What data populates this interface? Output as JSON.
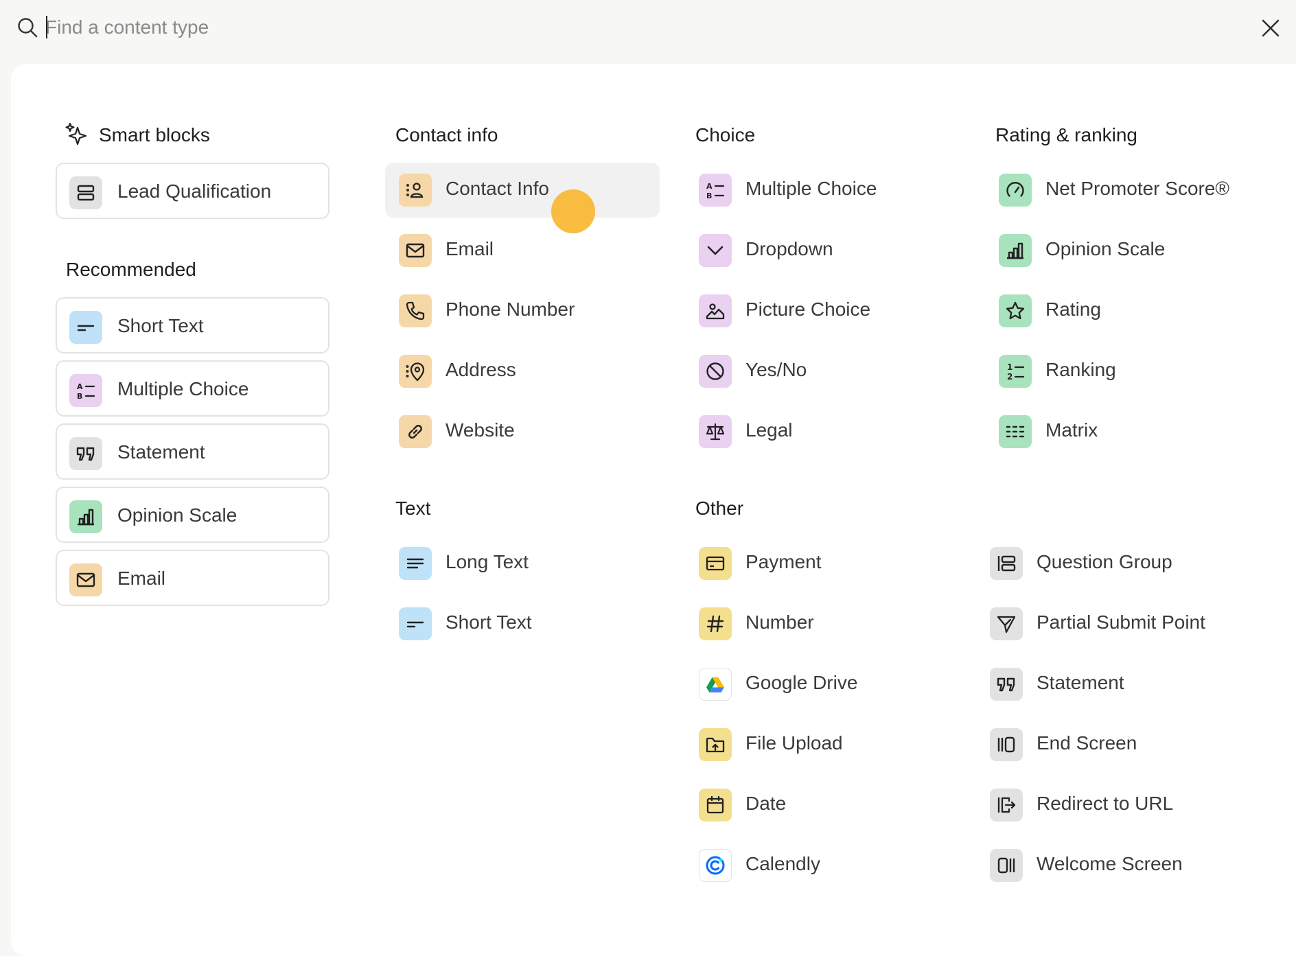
{
  "search": {
    "placeholder": "Find a content type",
    "value": ""
  },
  "sections": {
    "smart_blocks": {
      "title": "Smart blocks",
      "items": [
        {
          "label": "Lead Qualification",
          "icon": "stack-icon"
        }
      ]
    },
    "recommended": {
      "title": "Recommended",
      "items": [
        {
          "label": "Short Text",
          "icon": "short-text-icon"
        },
        {
          "label": "Multiple Choice",
          "icon": "multiple-choice-icon"
        },
        {
          "label": "Statement",
          "icon": "quote-icon"
        },
        {
          "label": "Opinion Scale",
          "icon": "bar-chart-icon"
        },
        {
          "label": "Email",
          "icon": "envelope-icon"
        }
      ]
    },
    "contact_info": {
      "title": "Contact info",
      "items": [
        {
          "label": "Contact Info",
          "icon": "contact-card-icon"
        },
        {
          "label": "Email",
          "icon": "envelope-icon"
        },
        {
          "label": "Phone Number",
          "icon": "phone-icon"
        },
        {
          "label": "Address",
          "icon": "location-pin-icon"
        },
        {
          "label": "Website",
          "icon": "link-icon"
        }
      ]
    },
    "choice": {
      "title": "Choice",
      "items": [
        {
          "label": "Multiple Choice",
          "icon": "multiple-choice-icon"
        },
        {
          "label": "Dropdown",
          "icon": "chevron-down-icon"
        },
        {
          "label": "Picture Choice",
          "icon": "image-icon"
        },
        {
          "label": "Yes/No",
          "icon": "yes-no-icon"
        },
        {
          "label": "Legal",
          "icon": "scales-icon"
        }
      ]
    },
    "rating": {
      "title": "Rating & ranking",
      "items": [
        {
          "label": "Net Promoter Score®",
          "icon": "gauge-icon"
        },
        {
          "label": "Opinion Scale",
          "icon": "bar-chart-icon"
        },
        {
          "label": "Rating",
          "icon": "star-icon"
        },
        {
          "label": "Ranking",
          "icon": "ranking-icon"
        },
        {
          "label": "Matrix",
          "icon": "matrix-icon"
        }
      ]
    },
    "text": {
      "title": "Text",
      "items": [
        {
          "label": "Long Text",
          "icon": "long-text-icon"
        },
        {
          "label": "Short Text",
          "icon": "short-text-icon"
        }
      ]
    },
    "other": {
      "title": "Other",
      "items": [
        {
          "label": "Payment",
          "icon": "credit-card-icon"
        },
        {
          "label": "Number",
          "icon": "hash-icon"
        },
        {
          "label": "Google Drive",
          "icon": "google-drive-icon"
        },
        {
          "label": "File Upload",
          "icon": "folder-upload-icon"
        },
        {
          "label": "Date",
          "icon": "calendar-icon"
        },
        {
          "label": "Calendly",
          "icon": "calendly-icon"
        },
        {
          "label": "Question Group",
          "icon": "question-group-icon"
        },
        {
          "label": "Partial Submit Point",
          "icon": "send-icon"
        },
        {
          "label": "Statement",
          "icon": "quote-icon"
        },
        {
          "label": "End Screen",
          "icon": "end-screen-icon"
        },
        {
          "label": "Redirect to URL",
          "icon": "redirect-icon"
        },
        {
          "label": "Welcome Screen",
          "icon": "welcome-screen-icon"
        }
      ]
    }
  },
  "colors": {
    "orange": "#f6d7a8",
    "purple": "#ead0f1",
    "green": "#a8e3bd",
    "blue": "#bfe2f8",
    "yellow": "#f4df8f",
    "gray": "#e2e2e2",
    "cursor": "#f7b731"
  }
}
